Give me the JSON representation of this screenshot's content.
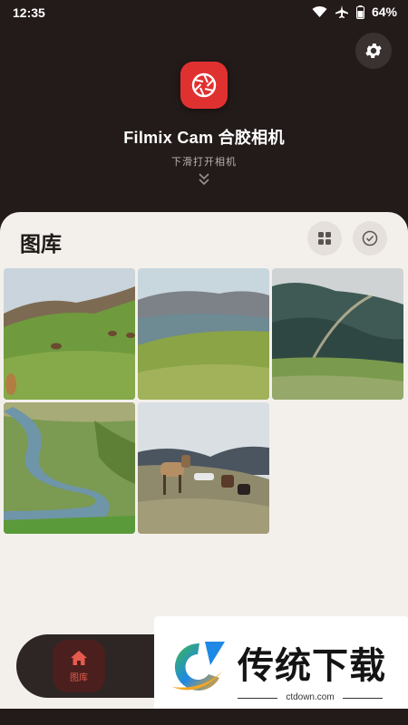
{
  "status_bar": {
    "time": "12:35",
    "battery": "64%"
  },
  "header": {
    "app_title": "Filmix Cam 合胶相机",
    "hint": "下滑打开相机",
    "settings_icon": "gear-icon",
    "logo_icon": "camera-aperture-icon",
    "brand_color": "#e03131"
  },
  "gallery": {
    "title": "图库",
    "view_toggle_icon": "grid-icon",
    "select_icon": "check-circle-icon",
    "photos": [
      {
        "name": "photo-hillside-deer"
      },
      {
        "name": "photo-valley-grassland"
      },
      {
        "name": "photo-mountain-rainbow"
      },
      {
        "name": "photo-river-valley"
      },
      {
        "name": "photo-horses-hill"
      }
    ]
  },
  "bottom_nav": {
    "home_label": "图库",
    "home_icon": "home-icon"
  },
  "watermark": {
    "brand": "传统下载",
    "domain": "ctdown.com"
  }
}
